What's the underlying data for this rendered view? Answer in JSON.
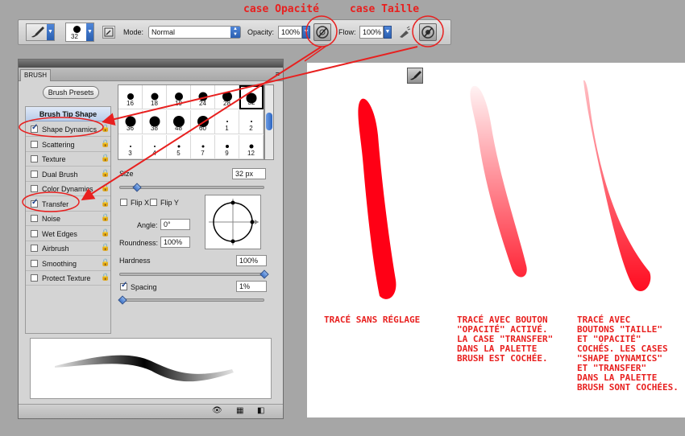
{
  "annotations": {
    "opacity_box": "case Opacité",
    "size_box": "case Taille"
  },
  "options_bar": {
    "brush_size": "32",
    "mode_label": "Mode:",
    "mode_value": "Normal",
    "opacity_label": "Opacity:",
    "opacity_value": "100%",
    "flow_label": "Flow:",
    "flow_value": "100%"
  },
  "brush_panel": {
    "tab_title": "BRUSH",
    "presets_button": "Brush Presets",
    "tip_shape_header": "Brush Tip Shape",
    "settings": [
      {
        "label": "Shape Dynamics",
        "checked": true
      },
      {
        "label": "Scattering",
        "checked": false
      },
      {
        "label": "Texture",
        "checked": false
      },
      {
        "label": "Dual Brush",
        "checked": false
      },
      {
        "label": "Color Dynamics",
        "checked": false
      },
      {
        "label": "Transfer",
        "checked": true
      },
      {
        "label": "Noise",
        "checked": false
      },
      {
        "label": "Wet Edges",
        "checked": false
      },
      {
        "label": "Airbrush",
        "checked": false
      },
      {
        "label": "Smoothing",
        "checked": false
      },
      {
        "label": "Protect Texture",
        "checked": false
      }
    ],
    "tips": [
      "16",
      "18",
      "19",
      "24",
      "28",
      "32",
      "36",
      "38",
      "48",
      "60",
      "1",
      "2",
      "3",
      "4",
      "5",
      "7",
      "9",
      "12"
    ],
    "selected_tip": "32",
    "size_label": "Size",
    "size_value": "32 px",
    "flip_x_label": "Flip X",
    "flip_y_label": "Flip Y",
    "angle_label": "Angle:",
    "angle_value": "0°",
    "roundness_label": "Roundness:",
    "roundness_value": "100%",
    "hardness_label": "Hardness",
    "hardness_value": "100%",
    "spacing_label": "Spacing",
    "spacing_value": "1%",
    "size_slider_fraction": 0.1,
    "hardness_slider_fraction": 1.0,
    "spacing_slider_fraction": 0.0
  },
  "captions": {
    "stroke1": "Tracé sans réglage",
    "stroke2_lines": [
      "Tracé avec bouton",
      "\"opacité\" activé.",
      "La case \"transfer\"",
      "dans la palette",
      "brush est cochée."
    ],
    "stroke3_lines": [
      "Tracé avec",
      "boutons \"taille\"",
      "et \"opacité\"",
      "cochés. Les cases",
      "\"shape dynamics\"",
      "et \"transfer\"",
      "dans la palette",
      "brush sont cochées."
    ]
  },
  "colors": {
    "annotation_red": "#e8201f",
    "stroke_red": "#ff0015"
  },
  "icons": [
    "brush-tool-icon",
    "brush-panel-toggle-icon",
    "opacity-pressure-icon",
    "airbrush-icon",
    "size-pressure-icon",
    "lock-icon",
    "eye-icon",
    "grid-icon",
    "new-preset-icon",
    "panel-menu-icon"
  ]
}
